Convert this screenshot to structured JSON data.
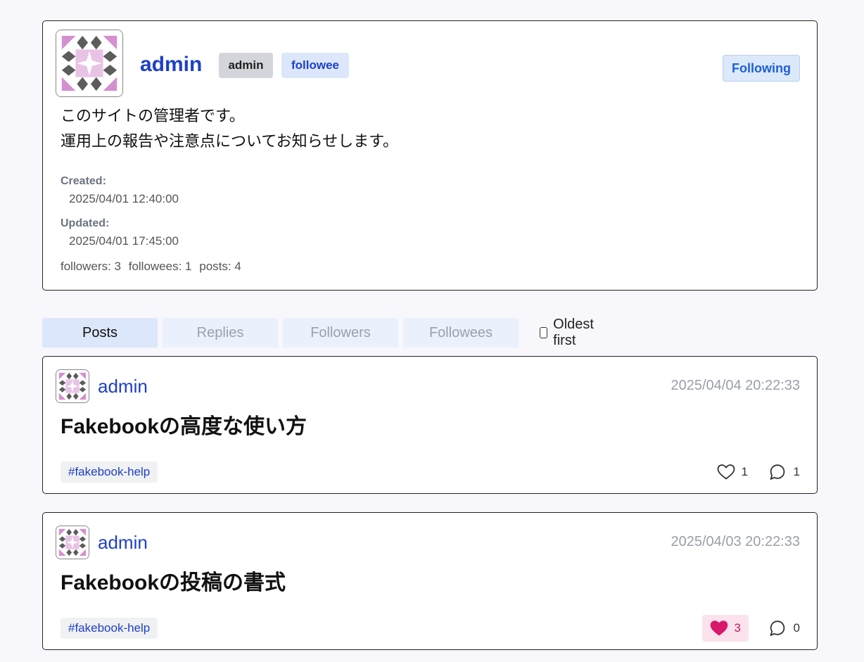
{
  "profile": {
    "name": "admin",
    "role_badge": "admin",
    "relation_badge": "followee",
    "follow_button": "Following",
    "bio_lines": [
      "このサイトの管理者です。",
      "運用上の報告や注意点についてお知らせします。"
    ],
    "created_label": "Created:",
    "created_value": "2025/04/01 12:40:00",
    "updated_label": "Updated:",
    "updated_value": "2025/04/01 17:45:00",
    "stats": {
      "followers": "followers: 3",
      "followees": "followees: 1",
      "posts": "posts: 4"
    }
  },
  "tabs": {
    "posts": "Posts",
    "replies": "Replies",
    "followers": "Followers",
    "followees": "Followees",
    "oldest_first": "Oldest first"
  },
  "posts": [
    {
      "author": "admin",
      "time": "2025/04/04 20:22:33",
      "title": "Fakebookの高度な使い方",
      "tag": "#fakebook-help",
      "likes": "1",
      "liked": false,
      "replies": "1"
    },
    {
      "author": "admin",
      "time": "2025/04/03 20:22:33",
      "title": "Fakebookの投稿の書式",
      "tag": "#fakebook-help",
      "likes": "3",
      "liked": true,
      "replies": "0"
    }
  ],
  "colors": {
    "accent": "#1e40c8",
    "liked": "#d8186a",
    "avatar_pink": "#d48fcf",
    "avatar_light": "#e9c3e5",
    "avatar_gray": "#5c5c5c"
  },
  "icons": {
    "avatar": "identicon",
    "like": "heart-icon",
    "reply": "speech-bubble-icon"
  }
}
